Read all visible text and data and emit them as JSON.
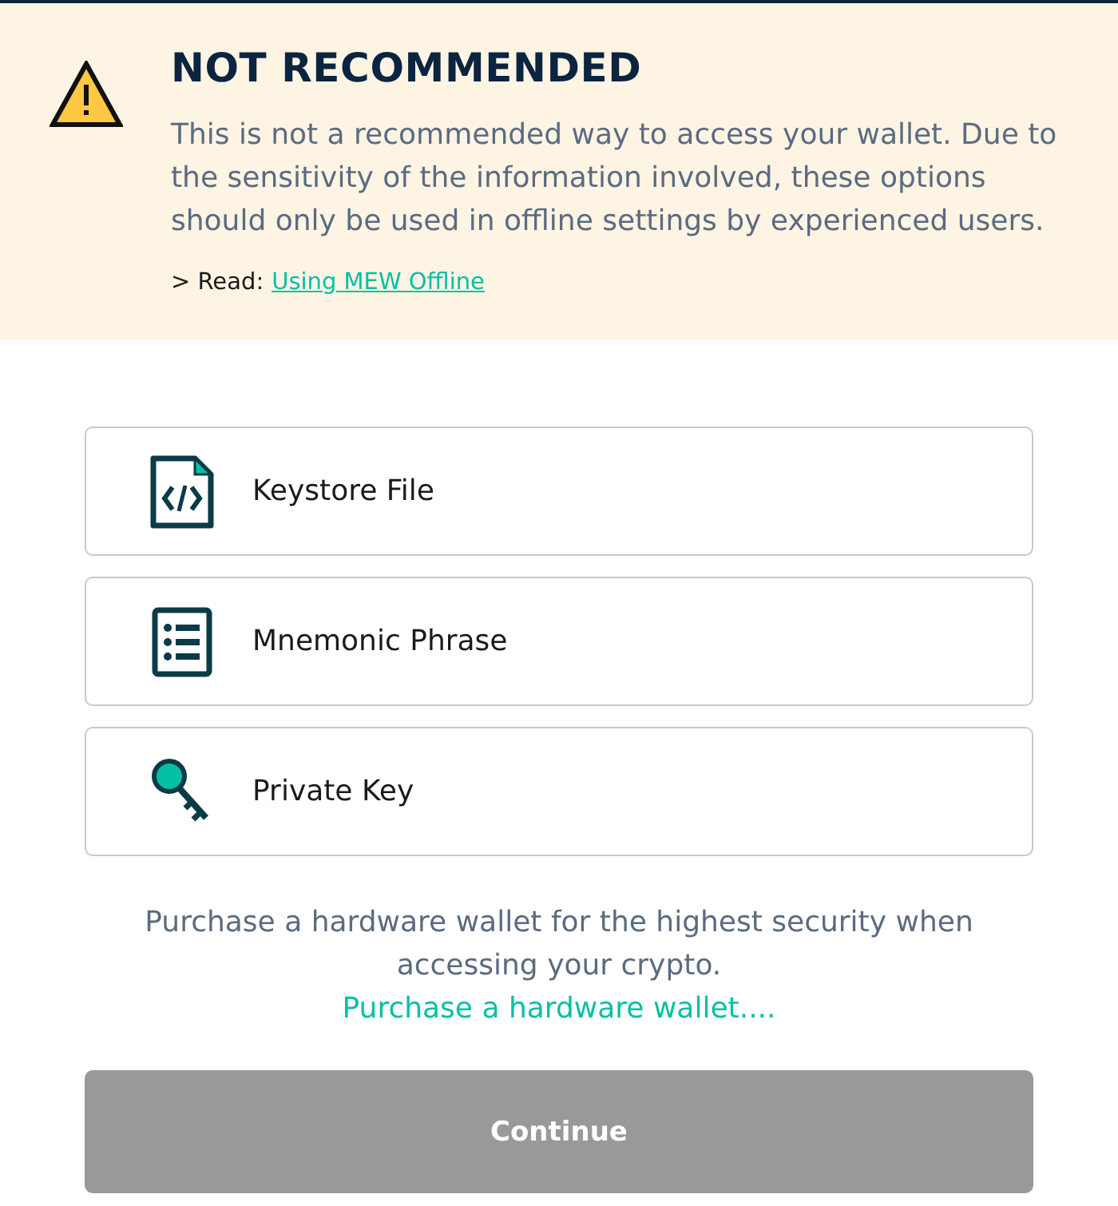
{
  "warning": {
    "title": "NOT RECOMMENDED",
    "message": "This is not a recommended way to access your wallet. Due to the sensitivity of the information involved, these options should only be used in offline settings by experienced users.",
    "read_prefix": "> Read:",
    "read_link": "Using MEW Offline"
  },
  "options": [
    {
      "label": "Keystore File",
      "selected": false
    },
    {
      "label": "Mnemonic Phrase",
      "selected": false
    },
    {
      "label": "Private Key",
      "selected": false
    }
  ],
  "hardware_note": {
    "text": "Purchase a hardware wallet for the highest security when accessing your crypto.",
    "link": "Purchase a hardware wallet...."
  },
  "continue_button": {
    "label": "Continue",
    "disabled": true
  }
}
